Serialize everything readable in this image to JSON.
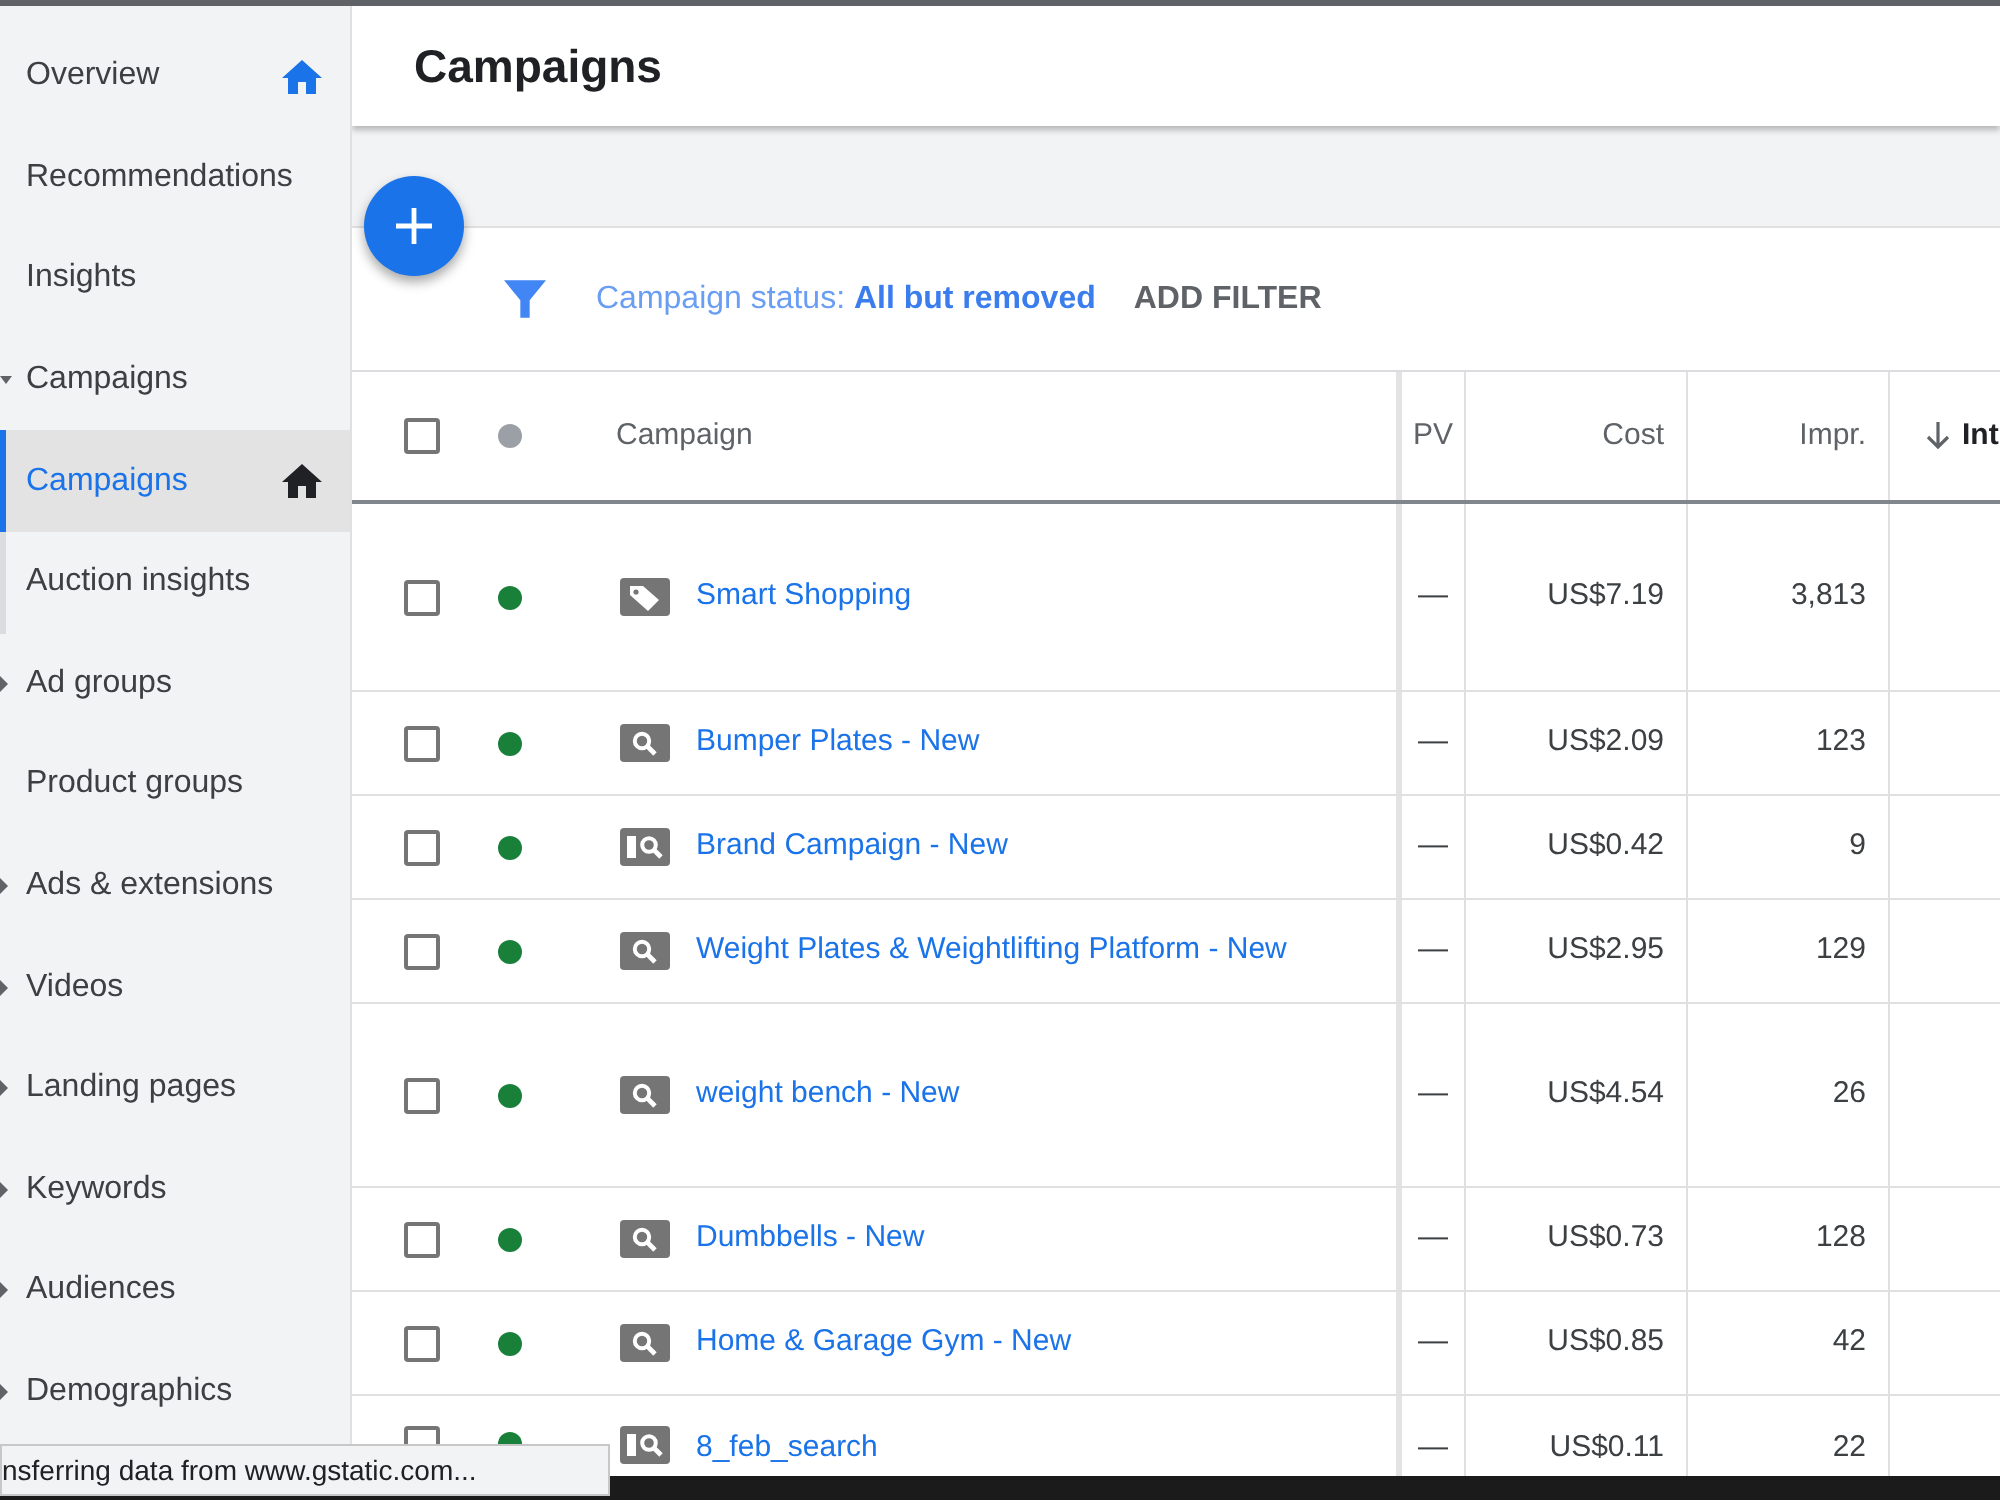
{
  "sidebar": {
    "items": [
      {
        "label": "Overview",
        "selected": false,
        "home_icon": {
          "color": "#1a73e8"
        }
      },
      {
        "label": "Recommendations",
        "selected": false
      },
      {
        "label": "Insights",
        "selected": false
      },
      {
        "label": "Campaigns",
        "selected": false,
        "expanded": true,
        "children": [
          {
            "label": "Campaigns",
            "selected": true,
            "home_icon": {
              "color": "#202124"
            }
          },
          {
            "label": "Auction insights",
            "selected": false
          }
        ]
      },
      {
        "label": "Ad groups",
        "selected": false,
        "expanded": false
      },
      {
        "label": "Product groups",
        "selected": false
      },
      {
        "label": "Ads & extensions",
        "selected": false,
        "expanded": false
      },
      {
        "label": "Videos",
        "selected": false,
        "expanded": false
      },
      {
        "label": "Landing pages",
        "selected": false,
        "expanded": false
      },
      {
        "label": "Keywords",
        "selected": false,
        "expanded": false
      },
      {
        "label": "Audiences",
        "selected": false,
        "expanded": false
      },
      {
        "label": "Demographics",
        "selected": false,
        "expanded": false
      }
    ]
  },
  "header": {
    "title": "Campaigns"
  },
  "filter_bar": {
    "filter": "Campaign status: **All but removed**",
    "add_filter": "ADD FILTER"
  },
  "table": {
    "select_all": {
      "checked": false
    },
    "columns": [
      {
        "label": "Campaign",
        "sorted": false
      },
      {
        "label": "PV",
        "sorted": false
      },
      {
        "label": "Cost",
        "sorted": false
      },
      {
        "label": "Impr.",
        "sorted": false
      },
      {
        "label": "Int",
        "sorted": true
      }
    ],
    "rows": [
      {
        "checked": false,
        "color": "#188038",
        "kind": "shopping",
        "campaign": "Smart Shopping",
        "column_2": "—",
        "cost": "US$7.19",
        "impr": "3,813"
      },
      {
        "checked": false,
        "color": "#188038",
        "kind": "search",
        "campaign": "Bumper Plates - New",
        "column_2": "—",
        "cost": "US$2.09",
        "impr": "123"
      },
      {
        "checked": false,
        "color": "#188038",
        "kind": "hybrid",
        "campaign": "Brand Campaign - New",
        "column_2": "—",
        "cost": "US$0.42",
        "impr": "9"
      },
      {
        "checked": false,
        "color": "#188038",
        "kind": "search",
        "campaign": "Weight Plates & Weightlifting Platform - New",
        "column_2": "—",
        "cost": "US$2.95",
        "impr": "129"
      },
      {
        "checked": false,
        "color": "#188038",
        "kind": "search",
        "campaign": "weight bench - New",
        "column_2": "—",
        "cost": "US$4.54",
        "impr": "26"
      },
      {
        "checked": false,
        "color": "#188038",
        "kind": "search",
        "campaign": "Dumbbells - New",
        "column_2": "—",
        "cost": "US$0.73",
        "impr": "128"
      },
      {
        "checked": false,
        "color": "#188038",
        "kind": "search",
        "campaign": "Home & Garage Gym - New",
        "column_2": "—",
        "cost": "US$0.85",
        "impr": "42"
      },
      {
        "checked": false,
        "color": "#188038",
        "kind": "hybrid",
        "campaign": "8_feb_search",
        "column_2": "—",
        "cost": "US$0.11",
        "impr": "22"
      }
    ]
  },
  "status_bar": {
    "text": "nsferring data from www.gstatic.com..."
  }
}
